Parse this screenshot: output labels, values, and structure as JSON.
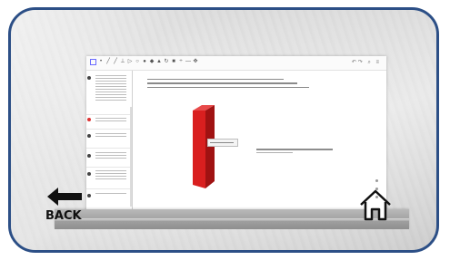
{
  "navigation": {
    "back_label": "BACK",
    "back_icon": "left-arrow-icon",
    "home_icon": "home-icon"
  },
  "app_window": {
    "toolbar_icons": [
      "select-icon",
      "point-icon",
      "line-icon",
      "perpendicular-icon",
      "polygon-icon",
      "sphere-icon",
      "plane-icon",
      "pyramid-icon",
      "rotate-icon",
      "slider-icon",
      "move-view-icon",
      "undo-icon",
      "redo-icon",
      "search-icon",
      "menu-icon"
    ],
    "object_color": "#d91f1f"
  },
  "colors": {
    "frame_border": "#2c4f86",
    "box_front": "#d91f1f",
    "box_side": "#a01212"
  }
}
